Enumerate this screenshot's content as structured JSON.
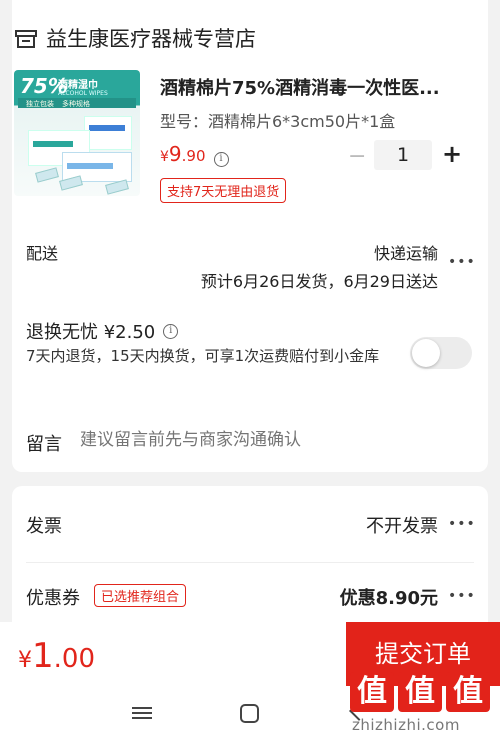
{
  "store": {
    "name": "益生康医疗器械专营店",
    "icon": "store-icon"
  },
  "product": {
    "title": "酒精棉片75%酒精消毒一次性医...",
    "spec": "型号：酒精棉片6*3cm50片*1盒",
    "price_symbol": "¥",
    "price_int": "9",
    "price_dec": ".90",
    "quantity": "1",
    "return_policy": "支持7天无理由退货",
    "image_text": {
      "big": "75%",
      "name": "酒精湿巾",
      "en": "ALCOHOL WIPES",
      "sub1": "独立包装",
      "sub2": "多种规格"
    }
  },
  "delivery": {
    "label": "配送",
    "method": "快递运输",
    "estimate": "预计6月26日发货，6月29日送达"
  },
  "worry_free": {
    "label": "退换无忧 ¥2.50",
    "description": "7天内退货，15天内换货，可享1次运费赔付到小金库",
    "enabled": false
  },
  "message": {
    "label": "留言",
    "placeholder": "建议留言前先与商家沟通确认"
  },
  "invoice": {
    "label": "发票",
    "value": "不开发票"
  },
  "coupon": {
    "label": "优惠券",
    "tag": "已选推荐组合",
    "value": "优惠8.90元"
  },
  "footer": {
    "total_symbol": "¥",
    "total_int": "1",
    "total_dec": ".00",
    "submit_label": "提交订单"
  },
  "watermark": {
    "chars": [
      "值",
      "值",
      "值"
    ],
    "url": "zhizhizhi.com"
  },
  "colors": {
    "accent": "#e2231a",
    "price": "#e1251b"
  }
}
